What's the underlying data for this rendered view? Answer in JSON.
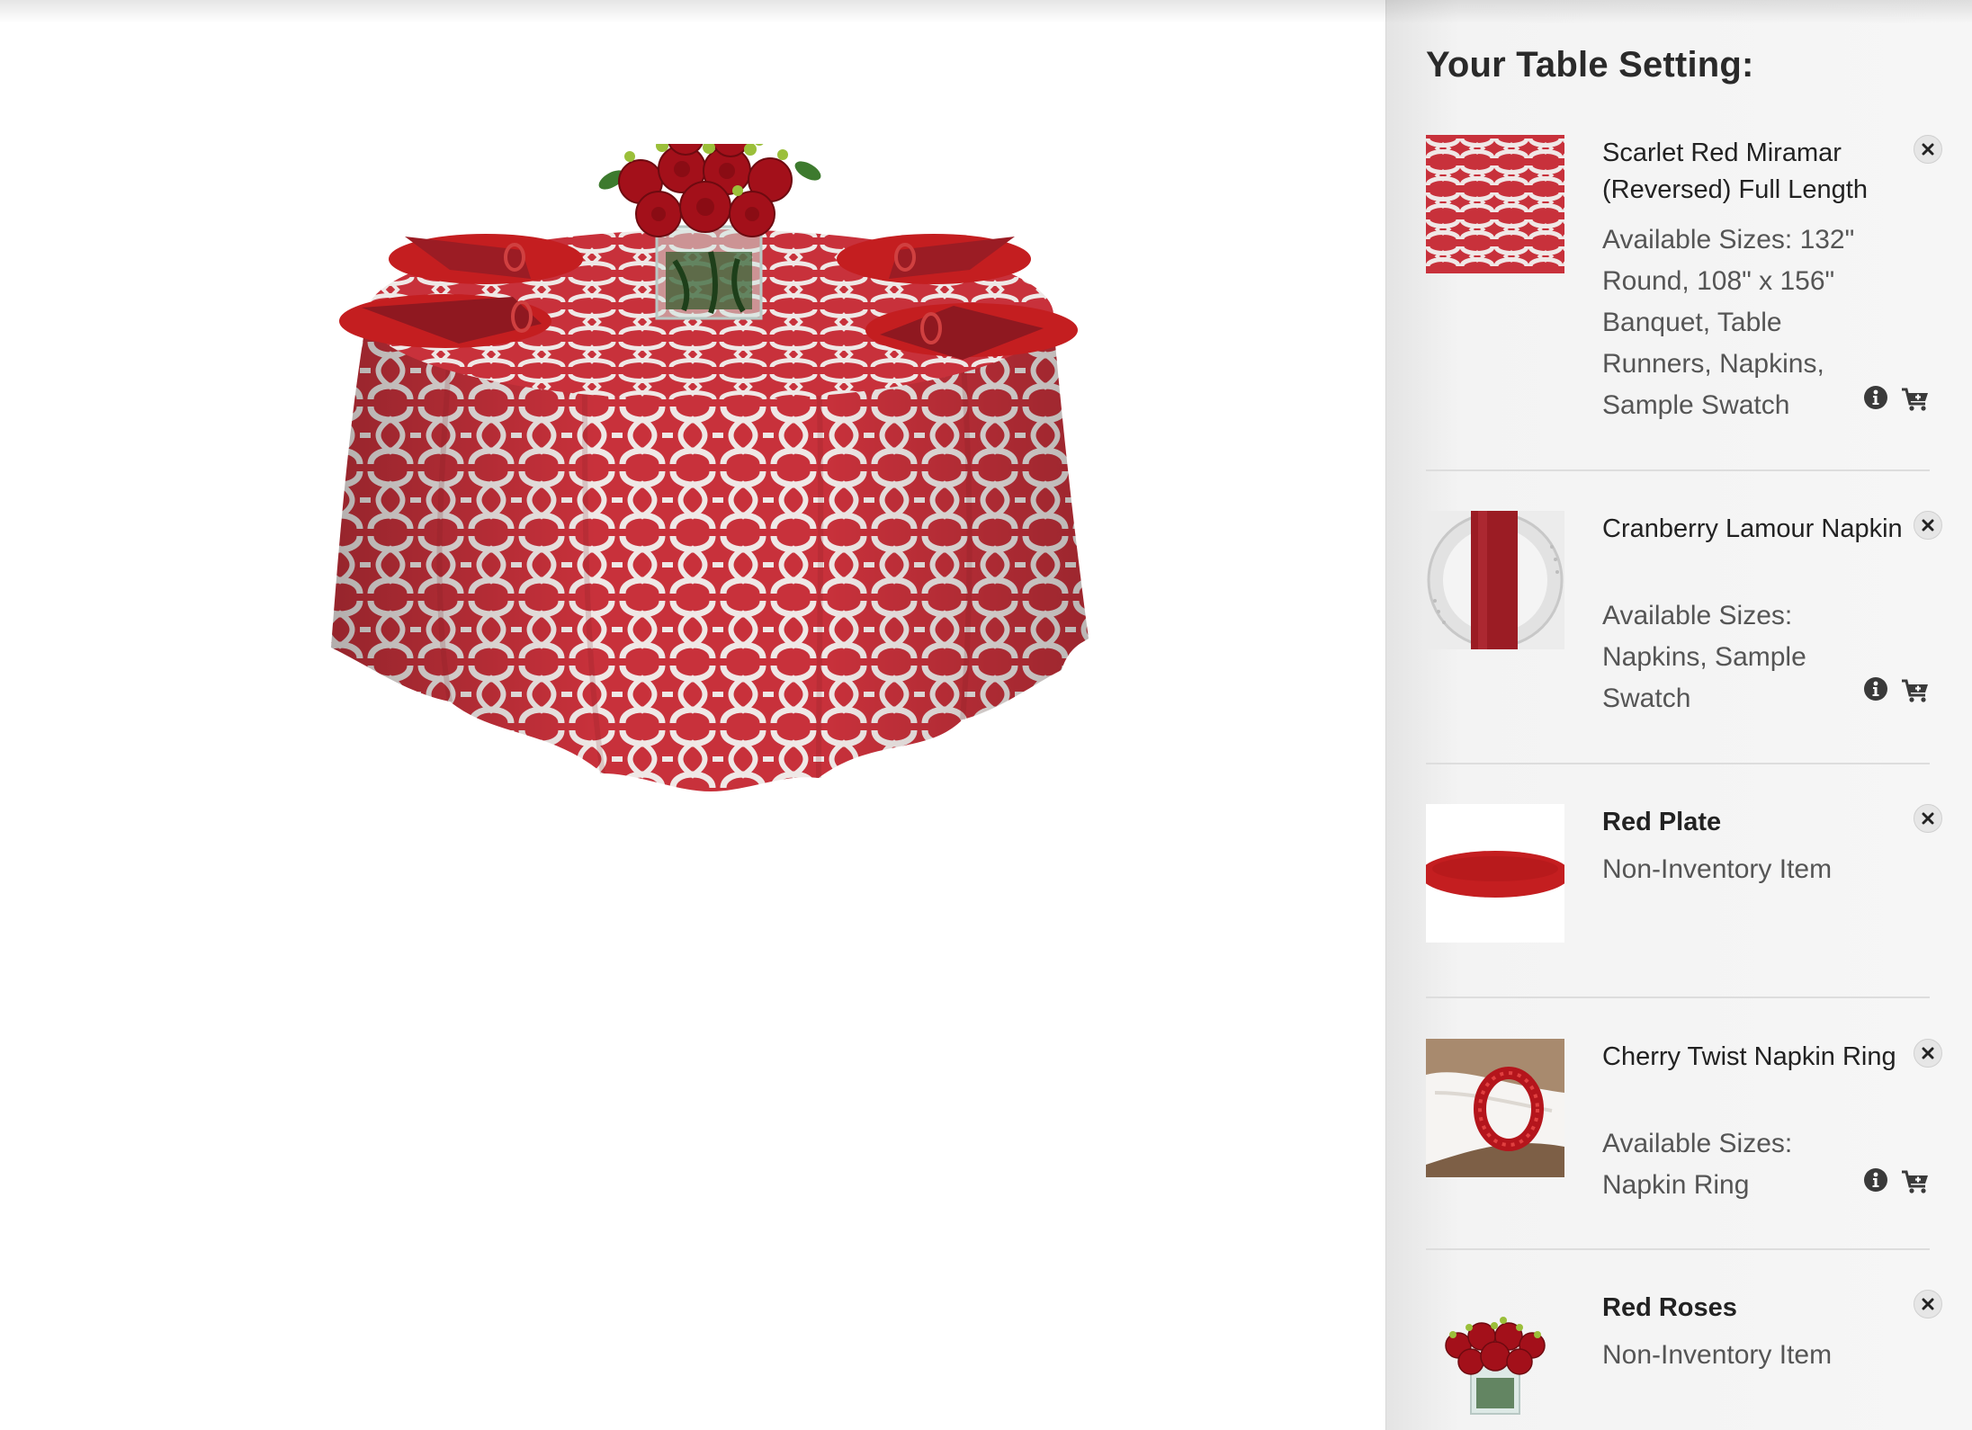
{
  "sidebar": {
    "title": "Your Table Setting:",
    "items": [
      {
        "title": "Scarlet Red Miramar (Reversed) Full Length",
        "description": "Available Sizes: 132\" Round, 108\" x 156\" Banquet, Table Runners, Napkins, Sample Swatch",
        "thumbnail": "red-white-pattern-swatch",
        "has_info": true,
        "has_cart": true
      },
      {
        "title": "Cranberry Lamour Napkin",
        "description": "Available Sizes: Napkins, Sample Swatch",
        "thumbnail": "folded-cranberry-napkin-on-plate",
        "has_info": true,
        "has_cart": true
      },
      {
        "title": "Red Plate",
        "description": "Non-Inventory Item",
        "thumbnail": "red-plate",
        "has_info": false,
        "has_cart": false
      },
      {
        "title": "Cherry Twist Napkin Ring",
        "description": "Available Sizes: Napkin Ring",
        "thumbnail": "cherry-napkin-ring",
        "has_info": true,
        "has_cart": true
      },
      {
        "title": "Red Roses",
        "description": "Non-Inventory Item",
        "thumbnail": "red-roses-vase",
        "has_info": false,
        "has_cart": false
      }
    ]
  },
  "icons": {
    "remove": "close-icon",
    "info": "info-icon",
    "cart": "add-to-cart-icon"
  },
  "colors": {
    "tablecloth_red": "#c8313b",
    "napkin": "#9b1c24",
    "plate": "#c41e20",
    "sidebar_bg": "#f3f3f3",
    "title_text": "#2a2a2a",
    "body_text": "#555555"
  }
}
